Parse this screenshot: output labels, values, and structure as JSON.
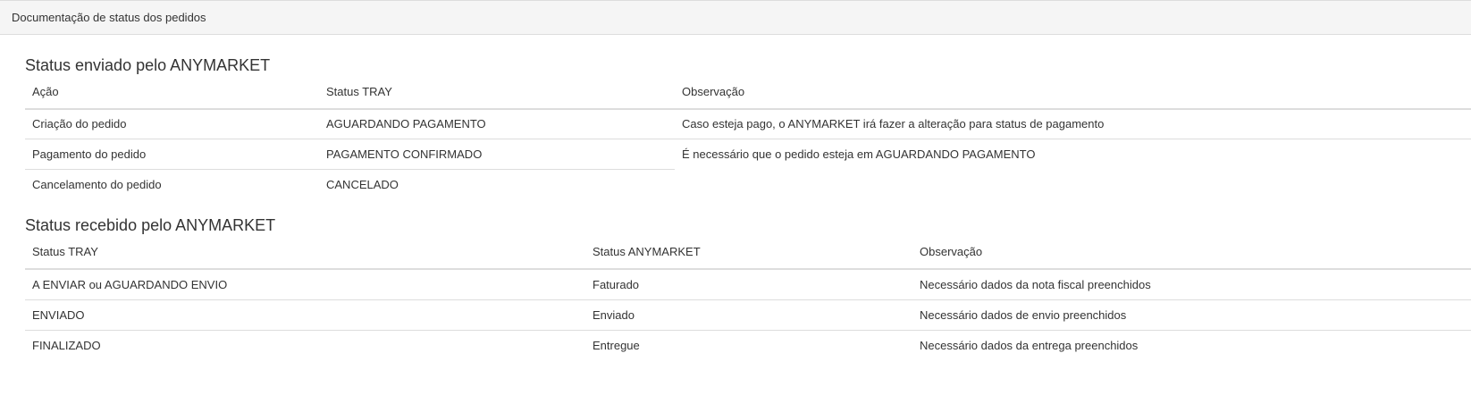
{
  "panel": {
    "title": "Documentação de status dos pedidos"
  },
  "sent": {
    "title": "Status enviado pelo ANYMARKET",
    "headers": [
      "Ação",
      "Status TRAY",
      "Observação"
    ],
    "rows": [
      [
        "Criação do pedido",
        "AGUARDANDO PAGAMENTO",
        "Caso esteja pago, o ANYMARKET irá fazer a alteração para status de pagamento"
      ],
      [
        "Pagamento do pedido",
        "PAGAMENTO CONFIRMADO",
        "É necessário que o pedido esteja em AGUARDANDO PAGAMENTO"
      ],
      [
        "Cancelamento do pedido",
        "CANCELADO",
        ""
      ]
    ]
  },
  "received": {
    "title": "Status recebido pelo ANYMARKET",
    "headers": [
      "Status TRAY",
      "Status ANYMARKET",
      "Observação"
    ],
    "rows": [
      [
        "A ENVIAR ou AGUARDANDO ENVIO",
        "Faturado",
        "Necessário dados da nota fiscal preenchidos"
      ],
      [
        "ENVIADO",
        "Enviado",
        "Necessário dados de envio preenchidos"
      ],
      [
        "FINALIZADO",
        "Entregue",
        "Necessário dados da entrega preenchidos"
      ]
    ]
  }
}
